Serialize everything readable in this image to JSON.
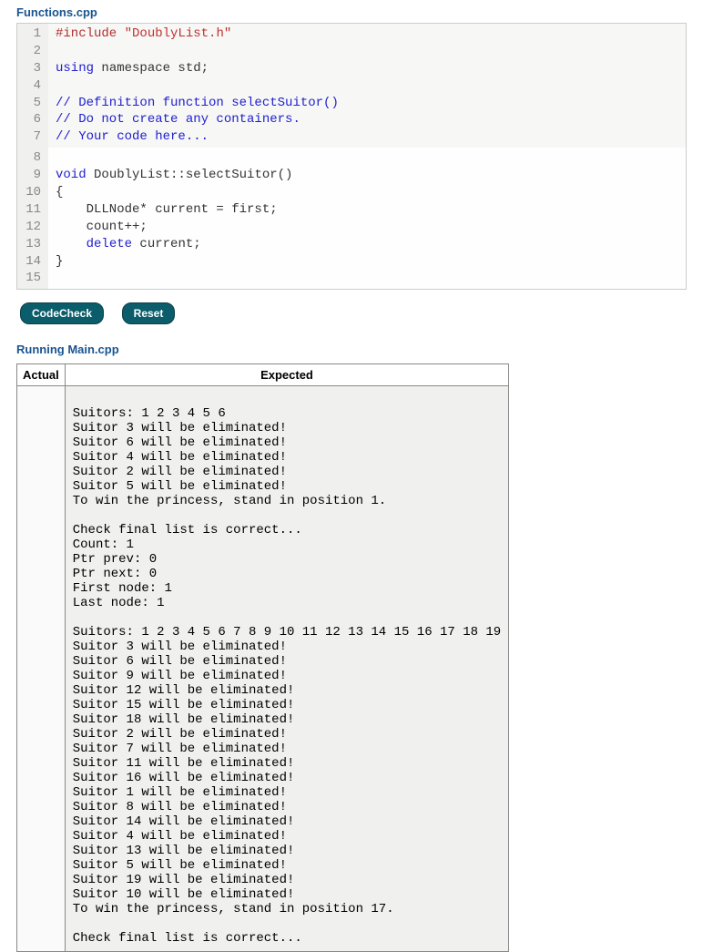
{
  "file_header": "Functions.cpp",
  "code_fixed": {
    "lines": [
      {
        "n": "1",
        "tokens": [
          [
            "pre",
            "#include "
          ],
          [
            "str",
            "\"DoublyList.h\""
          ]
        ]
      },
      {
        "n": "2",
        "tokens": []
      },
      {
        "n": "3",
        "tokens": [
          [
            "blue",
            "using "
          ],
          [
            "plain",
            "namespace std;"
          ]
        ]
      },
      {
        "n": "4",
        "tokens": []
      },
      {
        "n": "5",
        "tokens": [
          [
            "cmt",
            "// Definition function selectSuitor()"
          ]
        ]
      },
      {
        "n": "6",
        "tokens": [
          [
            "cmt",
            "// Do not create any containers."
          ]
        ]
      },
      {
        "n": "7",
        "tokens": [
          [
            "cmt",
            "// Your code here..."
          ]
        ]
      }
    ]
  },
  "code_editable": {
    "lines": [
      {
        "n": "8",
        "tokens": []
      },
      {
        "n": "9",
        "tokens": [
          [
            "blue",
            "void"
          ],
          [
            "plain",
            " DoublyList::selectSuitor()"
          ]
        ]
      },
      {
        "n": "10",
        "tokens": [
          [
            "plain",
            "{"
          ]
        ]
      },
      {
        "n": "11",
        "tokens": [
          [
            "plain",
            "    DLLNode* current = first;"
          ]
        ]
      },
      {
        "n": "12",
        "tokens": [
          [
            "plain",
            "    count++;"
          ]
        ]
      },
      {
        "n": "13",
        "tokens": [
          [
            "plain",
            "    "
          ],
          [
            "blue",
            "delete"
          ],
          [
            "plain",
            " current;"
          ]
        ]
      },
      {
        "n": "14",
        "tokens": [
          [
            "plain",
            "}"
          ]
        ]
      },
      {
        "n": "15",
        "tokens": []
      }
    ]
  },
  "buttons": {
    "codecheck": "CodeCheck",
    "reset": "Reset"
  },
  "running_header": "Running Main.cpp",
  "table": {
    "headers": {
      "actual": "Actual",
      "expected": "Expected"
    },
    "actual": "",
    "expected": "\nSuitors: 1 2 3 4 5 6\nSuitor 3 will be eliminated!\nSuitor 6 will be eliminated!\nSuitor 4 will be eliminated!\nSuitor 2 will be eliminated!\nSuitor 5 will be eliminated!\nTo win the princess, stand in position 1.\n\nCheck final list is correct...\nCount: 1\nPtr prev: 0\nPtr next: 0\nFirst node: 1\nLast node: 1\n\nSuitors: 1 2 3 4 5 6 7 8 9 10 11 12 13 14 15 16 17 18 19\nSuitor 3 will be eliminated!\nSuitor 6 will be eliminated!\nSuitor 9 will be eliminated!\nSuitor 12 will be eliminated!\nSuitor 15 will be eliminated!\nSuitor 18 will be eliminated!\nSuitor 2 will be eliminated!\nSuitor 7 will be eliminated!\nSuitor 11 will be eliminated!\nSuitor 16 will be eliminated!\nSuitor 1 will be eliminated!\nSuitor 8 will be eliminated!\nSuitor 14 will be eliminated!\nSuitor 4 will be eliminated!\nSuitor 13 will be eliminated!\nSuitor 5 will be eliminated!\nSuitor 19 will be eliminated!\nSuitor 10 will be eliminated!\nTo win the princess, stand in position 17.\n\nCheck final list is correct..."
  }
}
